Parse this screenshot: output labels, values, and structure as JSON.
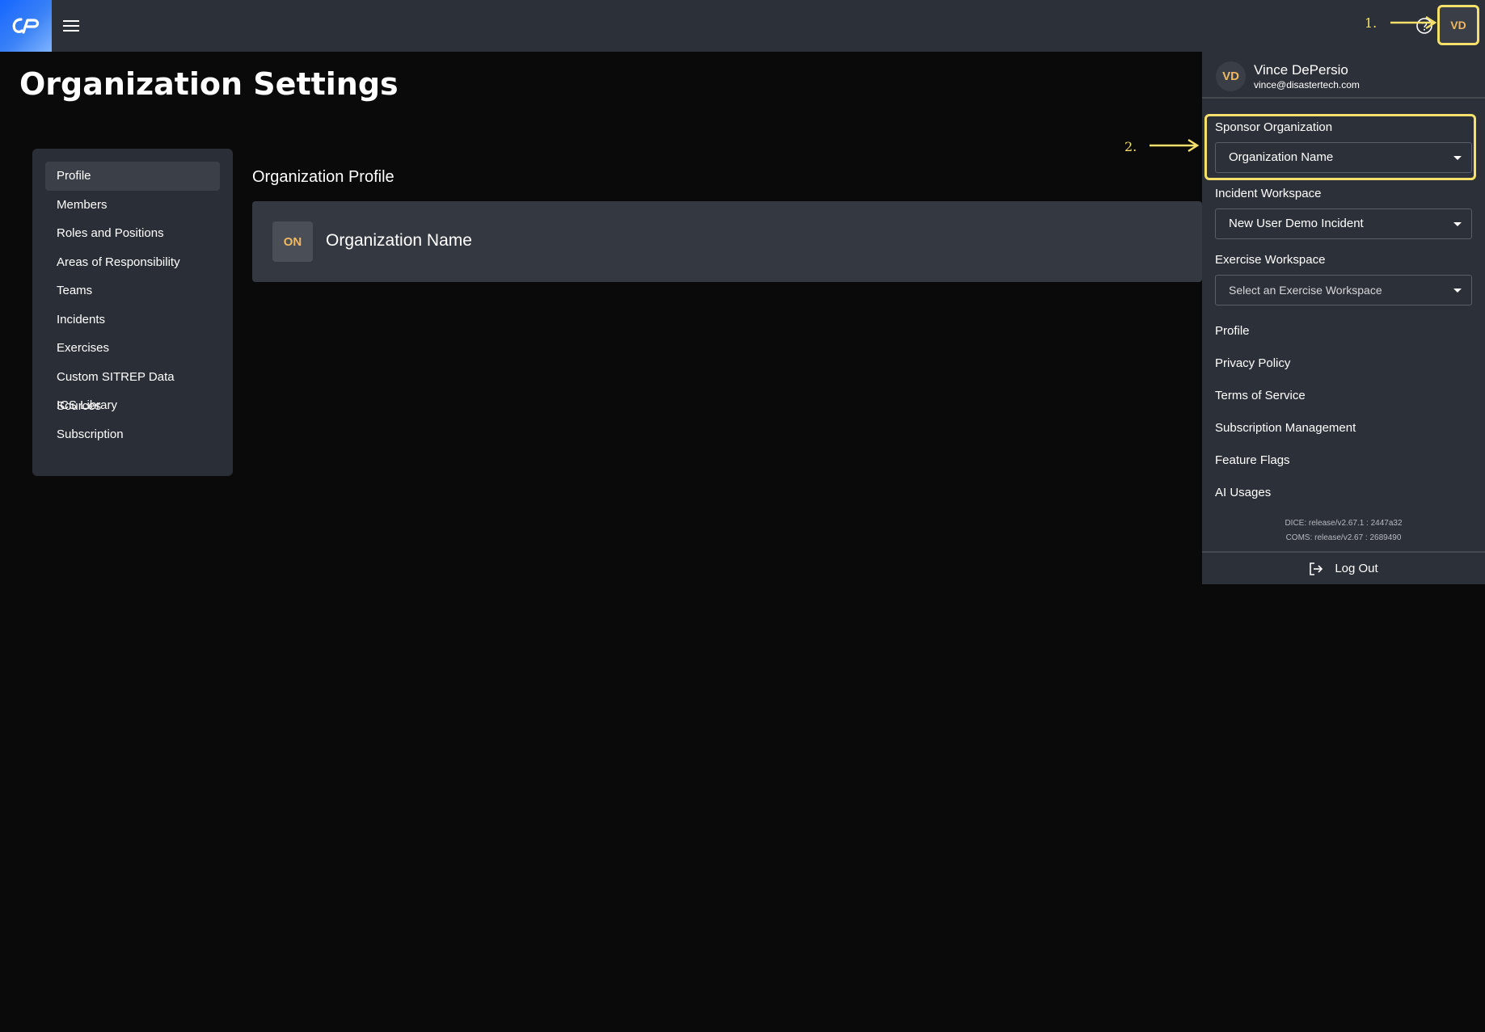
{
  "topbar": {
    "avatar_initials": "VD",
    "icons": {
      "logo": "app-logo",
      "menu": "hamburger-icon",
      "help": "help-icon"
    }
  },
  "annotations": {
    "step1": "1.",
    "step2": "2."
  },
  "page": {
    "title": "Organization Settings"
  },
  "sidebar": {
    "items": [
      {
        "label": "Profile",
        "active": true
      },
      {
        "label": "Members"
      },
      {
        "label": "Roles and Positions"
      },
      {
        "label": "Areas of Responsibility"
      },
      {
        "label": "Teams"
      },
      {
        "label": "Incidents"
      },
      {
        "label": "Exercises"
      },
      {
        "label": "Custom SITREP Data Sources"
      },
      {
        "label": "ICS Library"
      },
      {
        "label": "Subscription"
      }
    ]
  },
  "main": {
    "section_title": "Organization Profile",
    "org": {
      "badge": "ON",
      "name": "Organization Name"
    }
  },
  "dropdown": {
    "user": {
      "initials": "VD",
      "name": "Vince DePersio",
      "email": "vince@disastertech.com"
    },
    "sponsor": {
      "label": "Sponsor Organization",
      "value": "Organization Name"
    },
    "incident": {
      "label": "Incident Workspace",
      "value": "New User Demo Incident"
    },
    "exercise": {
      "label": "Exercise Workspace",
      "placeholder": "Select an Exercise Workspace"
    },
    "links": [
      "Profile",
      "Privacy Policy",
      "Terms of Service",
      "Subscription Management",
      "Feature Flags",
      "AI Usages"
    ],
    "versions": [
      "DICE: release/v2.67.1 : 2447a32",
      "COMS: release/v2.67 : 2689490"
    ],
    "logout_label": "Log Out"
  },
  "colors": {
    "background": "#0a0a0a",
    "topbar": "#2c3038",
    "panel": "#2c3038",
    "highlight": "#f4e06a",
    "accent_initials": "#f0b860"
  }
}
